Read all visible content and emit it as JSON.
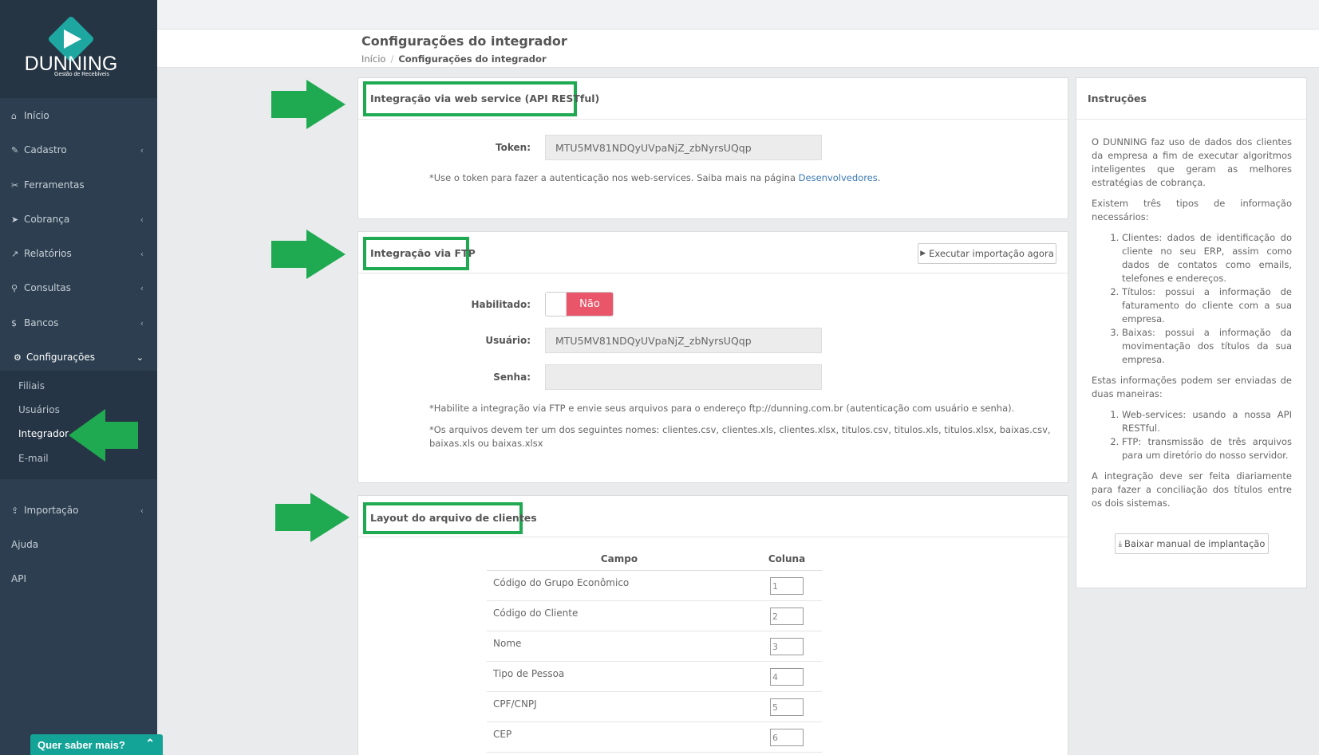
{
  "brand": {
    "name": "DUNNING",
    "tagline": "Gestão de Recebíveis"
  },
  "sidebar": {
    "items": [
      {
        "label": "Início",
        "icon": "home-icon"
      },
      {
        "label": "Cadastro",
        "icon": "edit-icon"
      },
      {
        "label": "Ferramentas",
        "icon": "wrench-icon"
      },
      {
        "label": "Cobrança",
        "icon": "send-icon"
      },
      {
        "label": "Relatórios",
        "icon": "chart-icon"
      },
      {
        "label": "Consultas",
        "icon": "search-icon"
      },
      {
        "label": "Bancos",
        "icon": "dollar-icon"
      },
      {
        "label": "Configurações",
        "icon": "gear-icon"
      },
      {
        "label": "Importação",
        "icon": "upload-icon"
      },
      {
        "label": "Ajuda"
      },
      {
        "label": "API"
      }
    ],
    "sub_items": [
      "Filiais",
      "Usuários",
      "Integrador",
      "E-mail"
    ],
    "help_widget": "Quer saber mais?"
  },
  "header": {
    "title": "Configurações do integrador",
    "breadcrumb": [
      "Início",
      "Configurações do integrador"
    ]
  },
  "api_panel": {
    "title": "Integração via web service (API RESTful)",
    "token_label": "Token:",
    "token_value": "MTU5MV81NDQyUVpaNjZ_zbNyrsUQqp",
    "note": "*Use o token para fazer a autenticação nos web-services. Saiba mais na página",
    "note_link": "Desenvolvedores",
    "note_end": "."
  },
  "ftp_panel": {
    "title": "Integração via FTP",
    "run_button": "Executar importação agora",
    "enabled_label": "Habilitado:",
    "enabled_value": "Não",
    "user_label": "Usuário:",
    "user_value": "MTU5MV81NDQyUVpaNjZ_zbNyrsUQqp",
    "password_label": "Senha:",
    "password_value": "",
    "note1": "*Habilite a integração via FTP e envie seus arquivos para o endereço ftp://dunning.com.br (autenticação com usuário e senha).",
    "note2": "*Os arquivos devem ter um dos seguintes nomes: clientes.csv, clientes.xls, clientes.xlsx, titulos.csv, titulos.xls, titulos.xlsx, baixas.csv, baixas.xls ou baixas.xlsx"
  },
  "layout_panel": {
    "title": "Layout do arquivo de clientes",
    "columns": [
      "Campo",
      "Coluna"
    ],
    "rows": [
      {
        "campo": "Código do Grupo Econômico",
        "coluna": "1"
      },
      {
        "campo": "Código do Cliente",
        "coluna": "2"
      },
      {
        "campo": "Nome",
        "coluna": "3"
      },
      {
        "campo": "Tipo de Pessoa",
        "coluna": "4"
      },
      {
        "campo": "CPF/CNPJ",
        "coluna": "5"
      },
      {
        "campo": "CEP",
        "coluna": "6"
      }
    ]
  },
  "instructions": {
    "title": "Instruções",
    "p1": "O DUNNING faz uso de dados dos clientes da empresa a fim de executar algoritmos inteligentes que geram as melhores estratégias de cobrança.",
    "p2": "Existem três tipos de informação necessários:",
    "list1": [
      "Clientes: dados de identificação do cliente no seu ERP, assim como dados de contatos como emails, telefones e endereços.",
      "Títulos: possui a informação de faturamento do cliente com a sua empresa.",
      "Baixas: possui a informação da movimentação dos títulos da sua empresa."
    ],
    "p3": "Estas informações podem ser enviadas de duas maneiras:",
    "list2": [
      "Web-services: usando a nossa API RESTful.",
      "FTP: transmissão de três arquivos para um diretório do nosso servidor."
    ],
    "p4": "A integração deve ser feita diariamente para fazer a conciliação dos títulos entre os dois sistemas.",
    "download_button": "Baixar manual de implantação"
  },
  "colors": {
    "sidebar": "#2c3e4f",
    "highlight": "#1faa52",
    "toggle_off": "#e9566a",
    "link": "#3a78b5"
  }
}
